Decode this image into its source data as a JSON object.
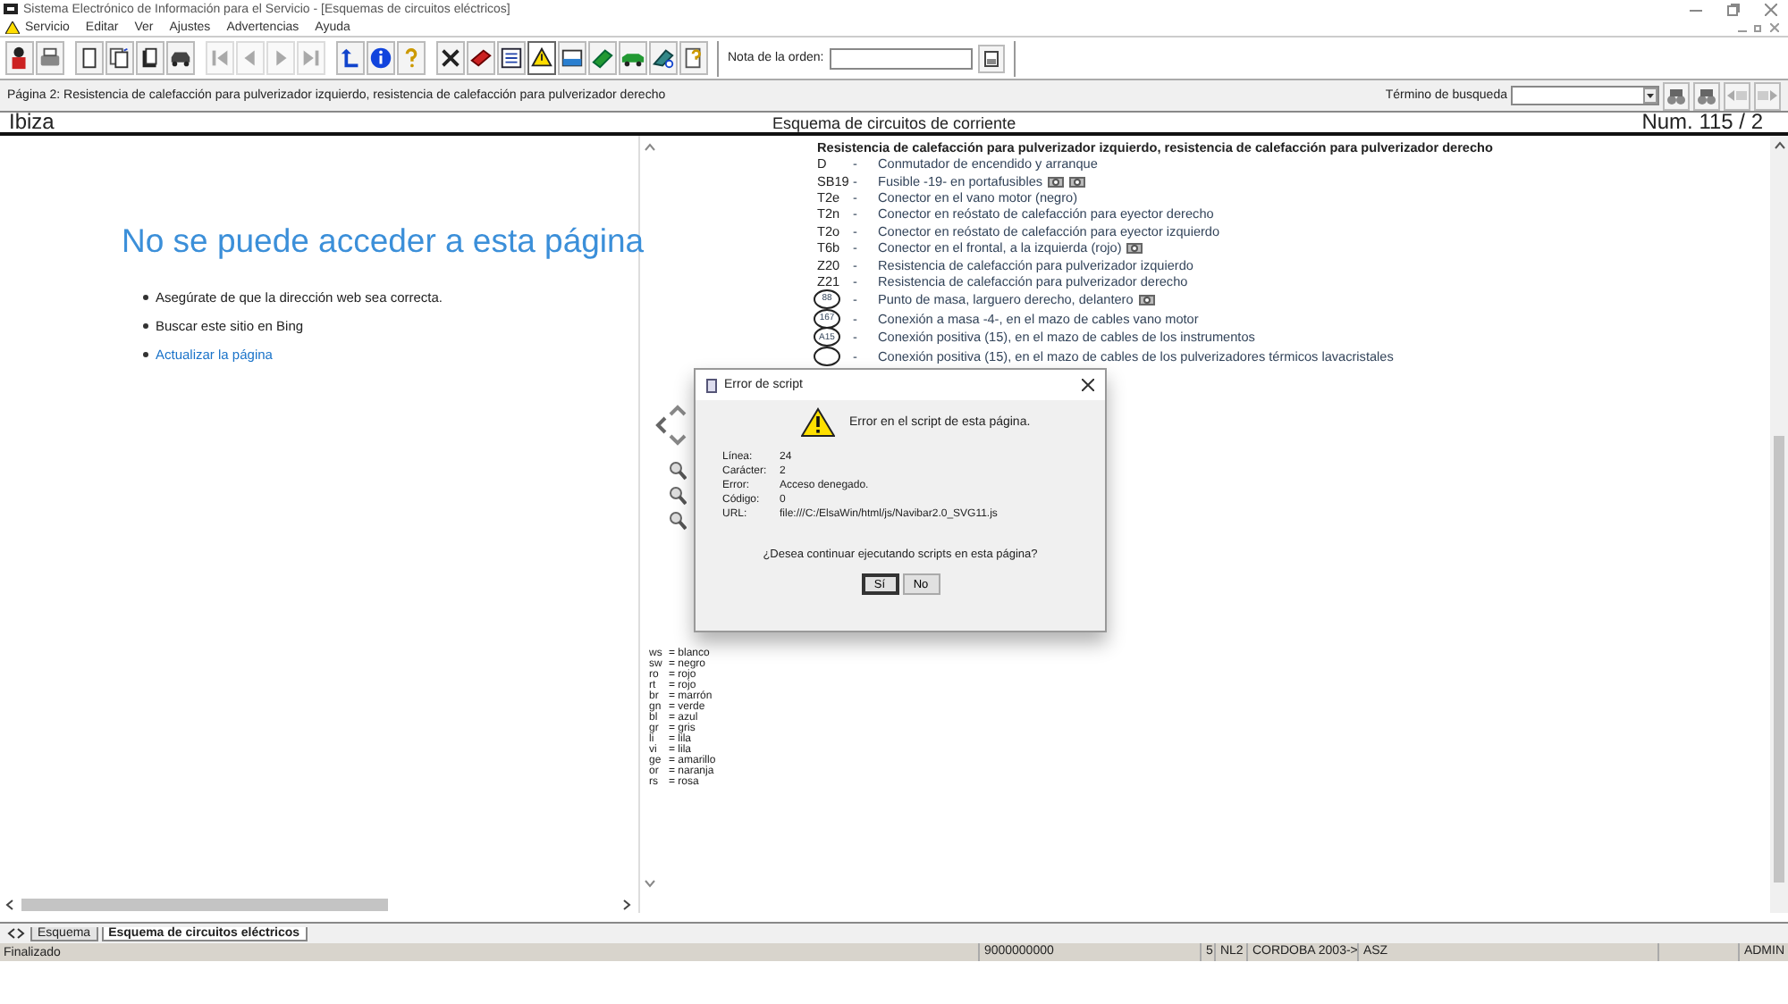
{
  "window": {
    "title": "Sistema Electrónico de Información para el Servicio - [Esquemas de circuitos eléctricos]"
  },
  "menu": [
    {
      "label": "Servicio",
      "kind": "warning"
    },
    {
      "label": "Editar",
      "kind": "plain"
    },
    {
      "label": "Ver",
      "kind": "plain"
    },
    {
      "label": "Ajustes",
      "kind": "plain"
    },
    {
      "label": "Advertencias",
      "kind": "plain"
    },
    {
      "label": "Ayuda",
      "kind": "plain"
    }
  ],
  "toolbar": [
    {
      "disabled": false,
      "pressed": false
    },
    {
      "disabled": false,
      "pressed": false
    },
    {
      "disabled": false,
      "pressed": false
    },
    {
      "disabled": false,
      "pressed": false
    },
    {
      "disabled": false,
      "pressed": false
    },
    {
      "disabled": false,
      "pressed": false
    },
    {
      "disabled": true,
      "pressed": false
    },
    {
      "disabled": true,
      "pressed": false
    },
    {
      "disabled": true,
      "pressed": false
    },
    {
      "disabled": true,
      "pressed": false
    },
    {
      "disabled": false,
      "pressed": false
    },
    {
      "disabled": false,
      "pressed": false
    },
    {
      "disabled": false,
      "pressed": false
    },
    {
      "disabled": false,
      "pressed": false
    },
    {
      "disabled": false,
      "pressed": false
    },
    {
      "disabled": false,
      "pressed": false
    },
    {
      "disabled": false,
      "pressed": true
    },
    {
      "disabled": false,
      "pressed": false
    },
    {
      "disabled": false,
      "pressed": false
    },
    {
      "disabled": false,
      "pressed": false
    },
    {
      "disabled": false,
      "pressed": false
    },
    {
      "disabled": false,
      "pressed": false
    }
  ],
  "order_note": {
    "label": "Nota de la orden:"
  },
  "page_line": "Página 2: Resistencia de calefacción para pulverizador izquierdo, resistencia de calefacción para pulverizador derecho",
  "search": {
    "label": "Término de busqueda"
  },
  "header": {
    "model": "Ibiza",
    "title": "Esquema de circuitos de corriente",
    "number": "Num.  115 / 2"
  },
  "browser_error": {
    "heading": "No se puede acceder a esta página",
    "items": [
      {
        "text": "Asegúrate de que la dirección web sea correcta.",
        "kind": "plain"
      },
      {
        "text": "Buscar este sitio en Bing",
        "kind": "plain"
      },
      {
        "text": "Actualizar la página",
        "kind": "link"
      }
    ]
  },
  "color_legend": [
    {
      "code": "ws",
      "name": "= blanco"
    },
    {
      "code": "sw",
      "name": "= negro"
    },
    {
      "code": "ro",
      "name": "= rojo"
    },
    {
      "code": "rt",
      "name": "= rojo"
    },
    {
      "code": "br",
      "name": "= marrón"
    },
    {
      "code": "gn",
      "name": "= verde"
    },
    {
      "code": "bl",
      "name": "= azul"
    },
    {
      "code": "gr",
      "name": "= gris"
    },
    {
      "code": "li",
      "name": "= lila"
    },
    {
      "code": "vi",
      "name": "= lila"
    },
    {
      "code": "ge",
      "name": "= amarillo"
    },
    {
      "code": "or",
      "name": "= naranja"
    },
    {
      "code": "rs",
      "name": "= rosa"
    }
  ],
  "legend": {
    "title": "Resistencia de calefacción para pulverizador izquierdo, resistencia de calefacción para pulverizador derecho",
    "items": [
      {
        "kind": "text",
        "code": "D",
        "dash": "-",
        "text": "Conmutador de encendido y arranque"
      },
      {
        "kind": "text",
        "code": "SB19",
        "dash": "-",
        "text": "Fusible -19- en portafusibles",
        "attachments": [
          {
            "kind": "photo"
          },
          {
            "kind": "photo"
          }
        ]
      },
      {
        "kind": "text",
        "code": "T2e",
        "dash": "-",
        "text": "Conector en el vano motor (negro)"
      },
      {
        "kind": "text",
        "code": "T2n",
        "dash": "-",
        "text": "Conector en reóstato de calefacción para eyector derecho"
      },
      {
        "kind": "text",
        "code": "T2o",
        "dash": "-",
        "text": "Conector en reóstato de calefacción para eyector izquierdo"
      },
      {
        "kind": "text",
        "code": "T6b",
        "dash": "-",
        "text": "Conector en el frontal, a la izquierda (rojo)",
        "attachments": [
          {
            "kind": "photo"
          }
        ]
      },
      {
        "kind": "text",
        "code": "Z20",
        "dash": "-",
        "text": "Resistencia de calefacción para pulverizador izquierdo"
      },
      {
        "kind": "text",
        "code": "Z21",
        "dash": "-",
        "text": "Resistencia de calefacción para pulverizador derecho"
      },
      {
        "kind": "circle",
        "code": "88",
        "dash": "-",
        "text": "Punto de masa, larguero derecho, delantero",
        "attachments": [
          {
            "kind": "photo"
          }
        ]
      },
      {
        "kind": "circle",
        "code": "167",
        "dash": "-",
        "text": "Conexión a masa -4-, en el mazo de cables vano motor"
      },
      {
        "kind": "circle",
        "code": "A15",
        "dash": "-",
        "text": "Conexión positiva (15), en el mazo de cables de los instrumentos"
      },
      {
        "kind": "circle",
        "dash": "-",
        "text": "Conexión positiva (15), en el mazo de cables de los pulverizadores térmicos lavacristales"
      }
    ]
  },
  "dialog": {
    "title": "Error de script",
    "message": "Error en el script de esta página.",
    "fields": [
      {
        "label": "Línea:",
        "value": "24"
      },
      {
        "label": "Carácter:",
        "value": "2"
      },
      {
        "label": "Error:",
        "value": "Acceso denegado."
      },
      {
        "label": "Código:",
        "value": "0"
      },
      {
        "label": "URL:",
        "value": "file:///C:/ElsaWin/html/js/Navibar2.0_SVG11.js"
      }
    ],
    "question": "¿Desea continuar ejecutando scripts en esta página?",
    "buttons": [
      {
        "label": "Sí",
        "selected": true
      },
      {
        "label": "No",
        "selected": false
      }
    ]
  },
  "sheet_tabs": [
    {
      "label": "Esquema",
      "selected": false
    },
    {
      "label": "Esquema de circuitos eléctricos",
      "selected": true
    }
  ],
  "status_bar": {
    "left": "Finalizado",
    "cells": [
      "9000000000",
      "5",
      "NL2",
      "CORDOBA 2003->",
      "ASZ",
      "ADMIN"
    ]
  }
}
